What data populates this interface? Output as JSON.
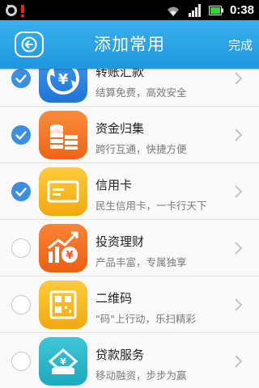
{
  "status_bar": {
    "time": "0:38",
    "icons": [
      "notification-icon",
      "alert-icon",
      "wifi-icon",
      "signal-icon",
      "battery-icon"
    ]
  },
  "header": {
    "title": "添加常用",
    "done_label": "完成",
    "back_icon": "back-arrow-icon",
    "color": "#2ba3e6"
  },
  "items": [
    {
      "title": "转账汇款",
      "subtitle": "结算免费，高效安全",
      "checked": true,
      "icon": "transfer-icon",
      "icon_color": "#2a86e0"
    },
    {
      "title": "资金归集",
      "subtitle": "跨行互通，快捷方便",
      "checked": true,
      "icon": "coins-icon",
      "icon_color": "#f5782a"
    },
    {
      "title": "信用卡",
      "subtitle": "民生信用卡，一卡行天下",
      "checked": true,
      "icon": "credit-card-icon",
      "icon_color": "#f7b81d"
    },
    {
      "title": "投资理财",
      "subtitle": "产品丰富，专属独享",
      "checked": false,
      "icon": "investment-icon",
      "icon_color": "#f47123"
    },
    {
      "title": "二维码",
      "subtitle": "\"码\"上行动，乐扫精彩",
      "checked": false,
      "icon": "qr-code-icon",
      "icon_color": "#f7b81d"
    },
    {
      "title": "贷款服务",
      "subtitle": "移动融资，步步为赢",
      "checked": false,
      "icon": "loan-icon",
      "icon_color": "#2cb6c9"
    }
  ]
}
